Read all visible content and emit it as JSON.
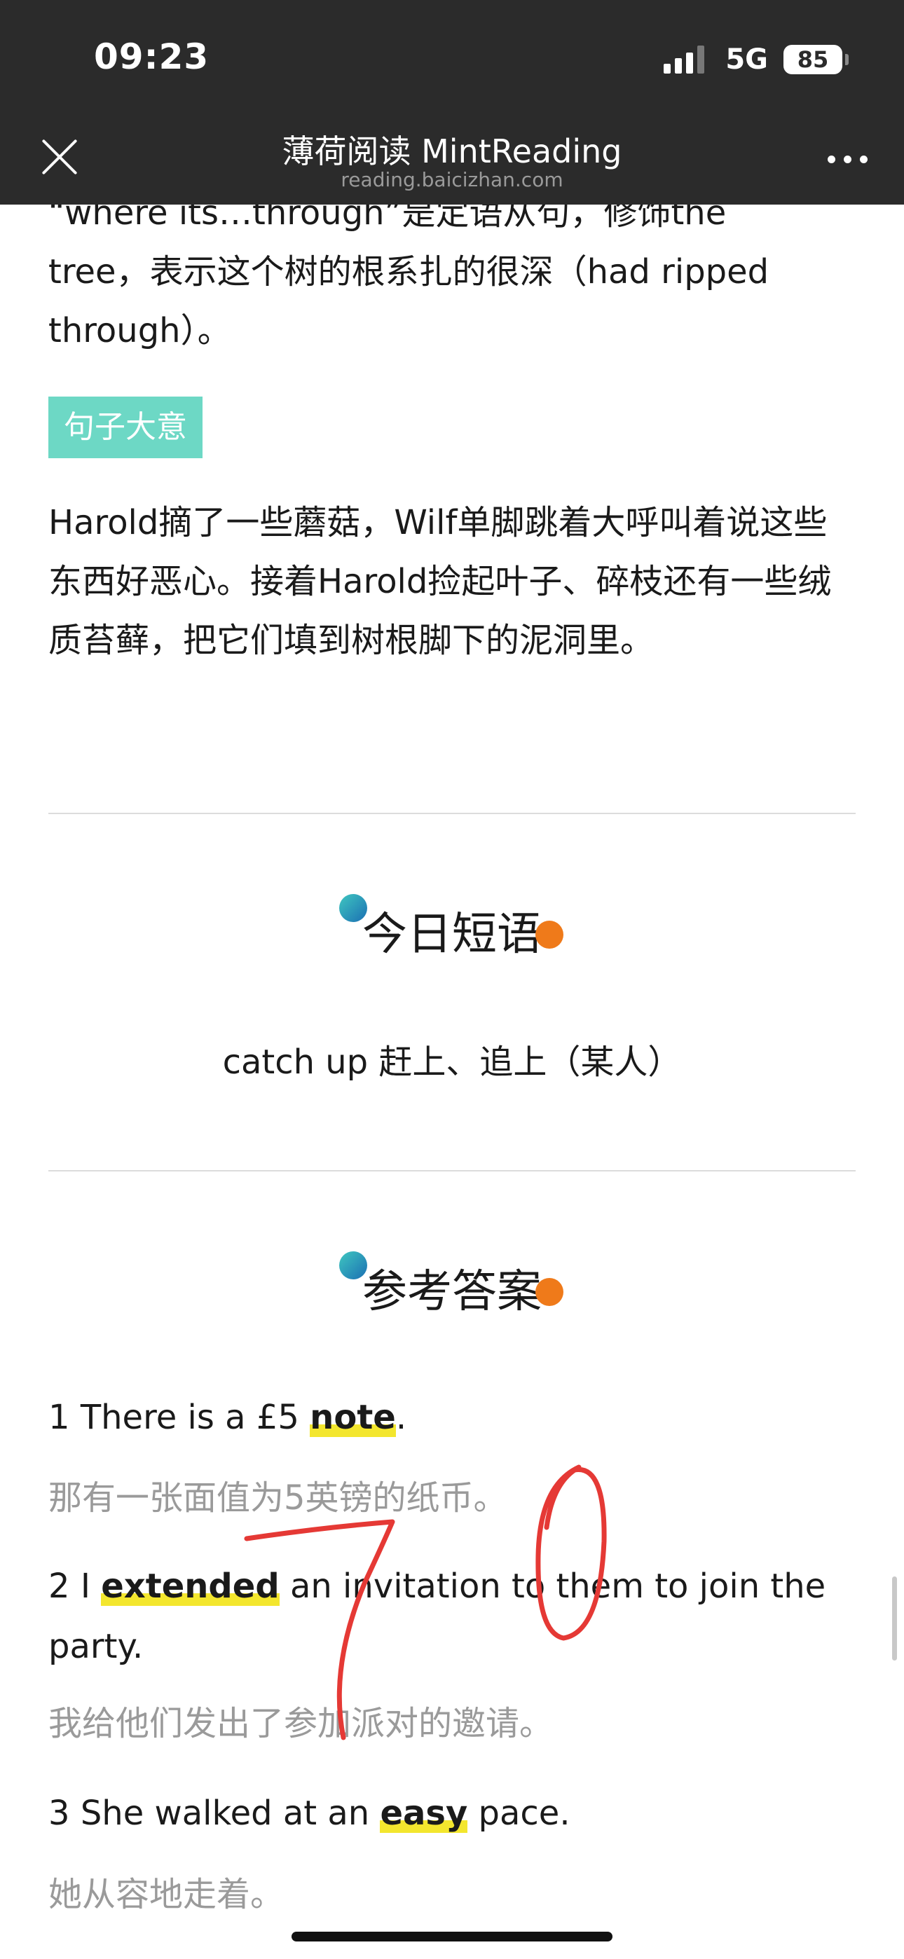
{
  "status_bar": {
    "time": "09:23",
    "network": "5G",
    "battery": "85"
  },
  "nav": {
    "title": "薄荷阅读 MintReading",
    "url": "reading.baicizhan.com"
  },
  "analysis": {
    "line1": "“where its…through”是定语从句，修饰the",
    "line2": "tree，表示这个树的根系扎的很深（had ripped",
    "line3": "through）。"
  },
  "sentence_meaning": {
    "tag": "句子大意",
    "text": "Harold摘了一些蘑菇，Wilf单脚跳着大呼叫着说这些东西好恶心。接着Harold捡起叶子、碎枝还有一些绒质苔藓，把它们填到树根脚下的泥洞里。"
  },
  "daily_phrase": {
    "title": "今日短语",
    "phrase": "catch up 赶上、追上（某人）"
  },
  "reference_answers": {
    "title": "参考答案",
    "items": [
      {
        "num": "1",
        "before": "There is a £5 ",
        "keyword": "note",
        "after": ".",
        "translation": "那有一张面值为5英镑的纸币。"
      },
      {
        "num": "2",
        "before": "I ",
        "keyword": "extended",
        "after": " an invitation to them to join the party.",
        "translation": "我给他们发出了参加派对的邀请。"
      },
      {
        "num": "3",
        "before": "She walked at an ",
        "keyword": "easy",
        "after": " pace.",
        "translation": "她从容地走着。"
      }
    ]
  },
  "handwriting": "70",
  "colors": {
    "chrome": "#2b2b2b",
    "tag": "#6dd8c5",
    "highlight": "#f3e62e",
    "annotation": "#e53935",
    "dot_orange": "#ef7a1a"
  }
}
